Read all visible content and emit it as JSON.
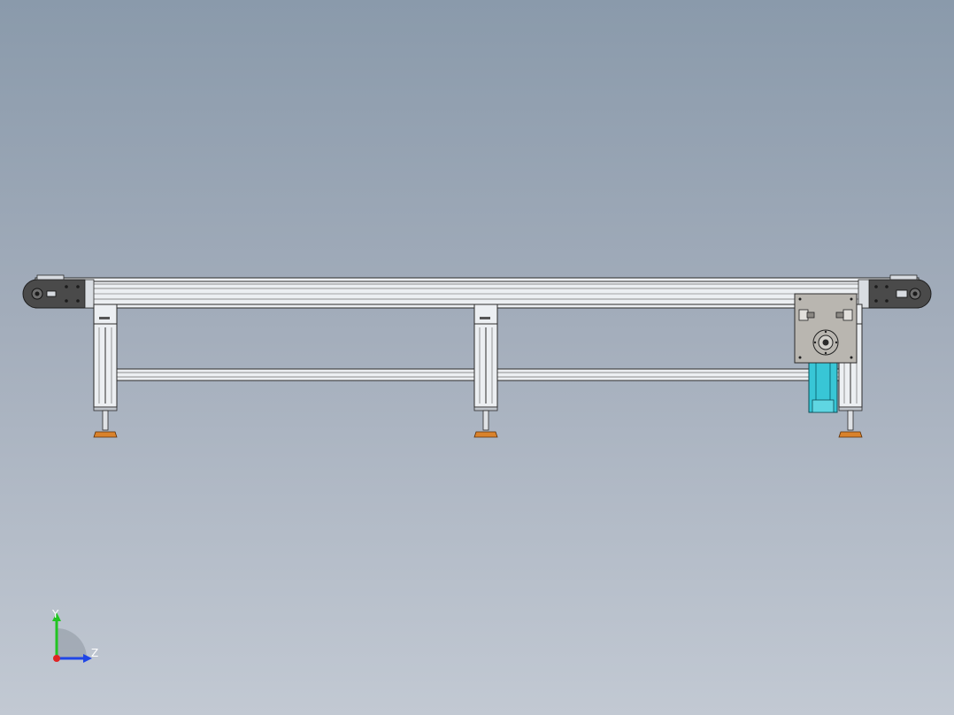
{
  "scene": {
    "background_top": "#8a9aab",
    "background_bottom": "#c2c9d3",
    "model": "belt-conveyor-side-view"
  },
  "colors": {
    "frame": "#eceff2",
    "frame_edge": "#2b2b2b",
    "end_cap": "#4a4a4a",
    "motor_plate": "#b9b6b0",
    "motor": "#38c6d6",
    "foot_pad": "#d9822b"
  },
  "triad": {
    "y_label": "Y",
    "z_label": "Z",
    "y_color": "#22c422",
    "z_color": "#1f46e6",
    "x_color": "#e02424"
  }
}
